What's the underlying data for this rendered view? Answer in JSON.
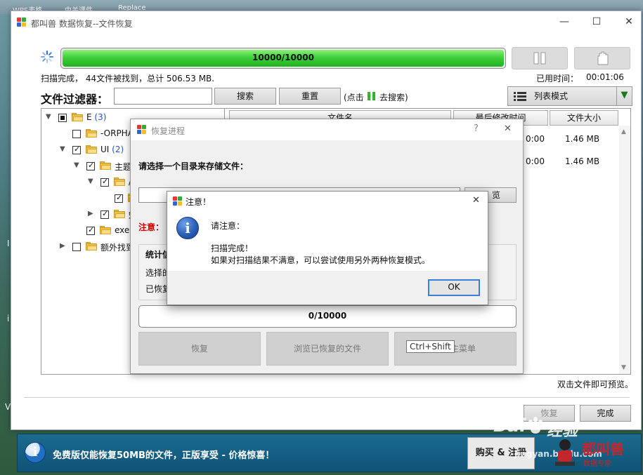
{
  "desktop": {
    "icon_labels": [
      "WPS表格",
      "中关课件",
      "Replace"
    ],
    "side_letters": [
      "I",
      "i",
      "V"
    ]
  },
  "window": {
    "title": "都叫兽 数据恢复--文件恢复",
    "controls": [
      "—",
      "☐",
      "✕"
    ]
  },
  "scan": {
    "progress_text": "10000/10000",
    "progress_fraction": 1.0,
    "status": "扫描完成， 44文件被找到，总计 506.53 MB.",
    "elapsed_label": "已用时间：",
    "elapsed_value": "00:01:06"
  },
  "filter": {
    "label": "文件过滤器：",
    "search_button": "搜索",
    "reset_button": "重置",
    "hint_prefix": "(点击",
    "hint_suffix": "去搜索)",
    "view_mode": "列表模式"
  },
  "tree": {
    "root_label": "E",
    "root_count": "(3)",
    "items": [
      {
        "label": "-ORPHA"
      },
      {
        "label": "UI",
        "count": "(2)"
      },
      {
        "label": "主题"
      },
      {
        "label": "/"
      },
      {
        "label": ""
      },
      {
        "label": "魅"
      },
      {
        "label": "exe"
      },
      {
        "label": "额外找到"
      }
    ]
  },
  "list": {
    "columns": [
      "文件名",
      "最后修改时间",
      "文件大小"
    ],
    "rows": [
      {
        "time": "0:00",
        "size": "1.46 MB"
      },
      {
        "time": "0:00",
        "size": "1.46 MB"
      }
    ],
    "footer_hint": "双击文件即可预览。"
  },
  "footer_buttons": {
    "recover": "恢复",
    "done": "完成"
  },
  "progress_dialog": {
    "title": "恢复进程",
    "help": "?",
    "close": "✕",
    "choose_dir_label": "请选择一个目录来存储文件：",
    "browse_fragment": "览",
    "note_label": "注意：",
    "stats_label": "统计信",
    "selected_label": "选择的",
    "recovered_label": "已恢复",
    "progress_text": "0/10000",
    "btn_recover": "恢复",
    "btn_browse_recovered": "浏览已恢复的文件",
    "btn_main_menu": "主菜单",
    "tooltip": "Ctrl+Shift"
  },
  "notice_dialog": {
    "title": "注意！",
    "close": "✕",
    "line1": "请注意：",
    "line2": "扫描完成！",
    "line3": "如果对扫描结果不满意，可以尝试使用另外两种恢复模式。",
    "ok": "OK"
  },
  "banner": {
    "text": "免费版仅能恢复50MB的文件，正版享受 - 价格惊喜！",
    "buy_button": "购买 & 注册"
  },
  "watermark": {
    "brand": "Bai",
    "brand2": "经验",
    "url": "jingyan.baidu.com",
    "logo_text": "都叫兽",
    "logo_sub": "数据专家"
  },
  "colors": {
    "progress_green": "#3fcf3c",
    "banner_blue": "#0f5378",
    "note_red": "#d40000",
    "ok_focus": "#3c7fd8"
  }
}
